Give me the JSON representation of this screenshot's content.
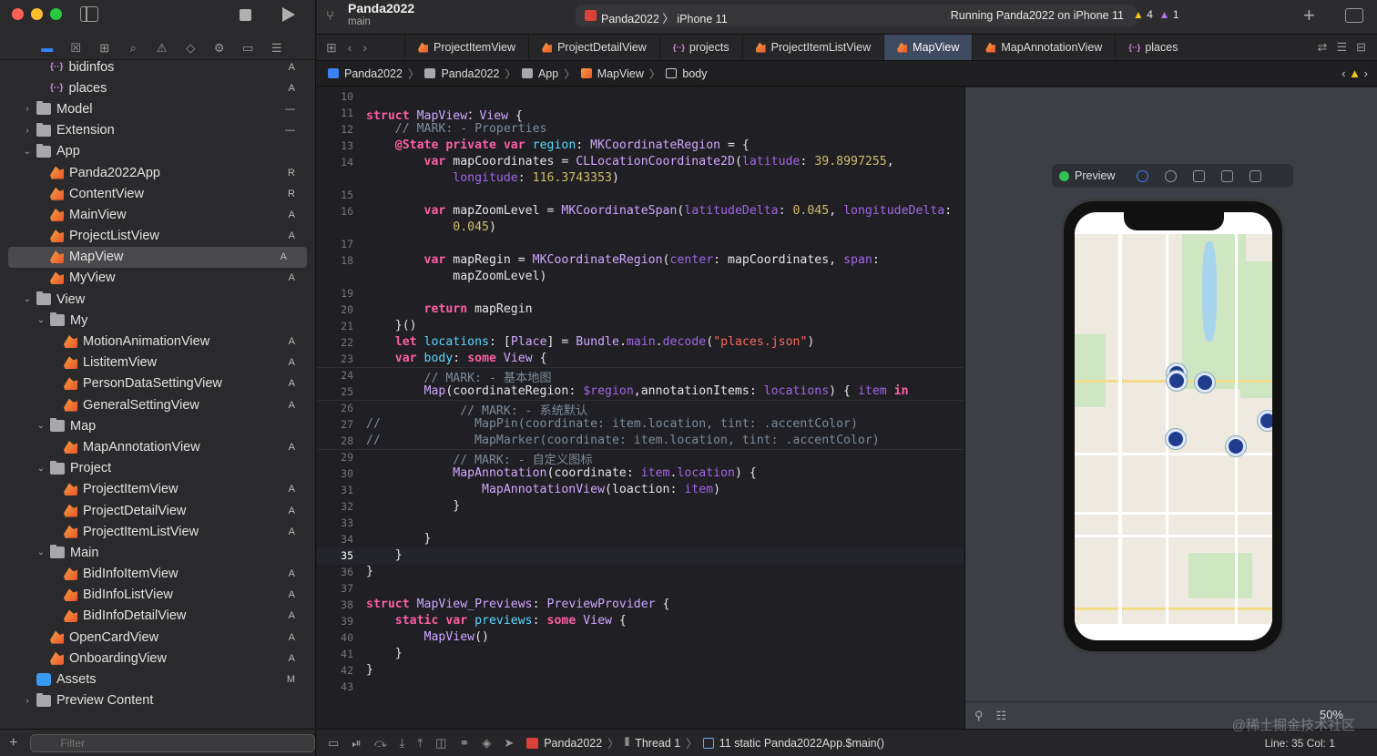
{
  "sidebar": {
    "filter_placeholder": "Filter",
    "items": [
      {
        "label": "bidinfos",
        "kind": "json",
        "indent": 1,
        "status": "A"
      },
      {
        "label": "places",
        "kind": "json",
        "indent": 1,
        "status": "A"
      },
      {
        "label": "Model",
        "kind": "folder",
        "indent": 0,
        "chev": "›",
        "status": "—"
      },
      {
        "label": "Extension",
        "kind": "folder",
        "indent": 0,
        "chev": "›",
        "status": "—"
      },
      {
        "label": "App",
        "kind": "folder",
        "indent": 0,
        "chev": "⌄",
        "status": ""
      },
      {
        "label": "Panda2022App",
        "kind": "swift",
        "indent": 1,
        "status": "R"
      },
      {
        "label": "ContentView",
        "kind": "swift",
        "indent": 1,
        "status": "R"
      },
      {
        "label": "MainView",
        "kind": "swift",
        "indent": 1,
        "status": "A"
      },
      {
        "label": "ProjectListView",
        "kind": "swift",
        "indent": 1,
        "status": "A"
      },
      {
        "label": "MapView",
        "kind": "swift",
        "indent": 1,
        "status": "A",
        "selected": true
      },
      {
        "label": "MyView",
        "kind": "swift",
        "indent": 1,
        "status": "A"
      },
      {
        "label": "View",
        "kind": "folder",
        "indent": 0,
        "chev": "⌄",
        "status": ""
      },
      {
        "label": "My",
        "kind": "folder",
        "indent": 1,
        "chev": "⌄",
        "status": ""
      },
      {
        "label": "MotionAnimationView",
        "kind": "swift",
        "indent": 2,
        "status": "A"
      },
      {
        "label": "ListitemView",
        "kind": "swift",
        "indent": 2,
        "status": "A"
      },
      {
        "label": "PersonDataSettingView",
        "kind": "swift",
        "indent": 2,
        "status": "A"
      },
      {
        "label": "GeneralSettingView",
        "kind": "swift",
        "indent": 2,
        "status": "A"
      },
      {
        "label": "Map",
        "kind": "folder",
        "indent": 1,
        "chev": "⌄",
        "status": ""
      },
      {
        "label": "MapAnnotationView",
        "kind": "swift",
        "indent": 2,
        "status": "A"
      },
      {
        "label": "Project",
        "kind": "folder",
        "indent": 1,
        "chev": "⌄",
        "status": ""
      },
      {
        "label": "ProjectItemView",
        "kind": "swift",
        "indent": 2,
        "status": "A"
      },
      {
        "label": "ProjectDetailView",
        "kind": "swift",
        "indent": 2,
        "status": "A"
      },
      {
        "label": "ProjectItemListView",
        "kind": "swift",
        "indent": 2,
        "status": "A"
      },
      {
        "label": "Main",
        "kind": "folder",
        "indent": 1,
        "chev": "⌄",
        "status": ""
      },
      {
        "label": "BidInfoItemView",
        "kind": "swift",
        "indent": 2,
        "status": "A"
      },
      {
        "label": "BidInfoListView",
        "kind": "swift",
        "indent": 2,
        "status": "A"
      },
      {
        "label": "BidInfoDetailView",
        "kind": "swift",
        "indent": 2,
        "status": "A"
      },
      {
        "label": "OpenCardView",
        "kind": "swift",
        "indent": 1,
        "status": "A"
      },
      {
        "label": "OnboardingView",
        "kind": "swift",
        "indent": 1,
        "status": "A"
      },
      {
        "label": "Assets",
        "kind": "assets",
        "indent": 0,
        "status": "M"
      },
      {
        "label": "Preview Content",
        "kind": "folder",
        "indent": 0,
        "chev": "›",
        "status": ""
      }
    ]
  },
  "toolbar": {
    "project": "Panda2022",
    "branch": "main",
    "scheme": "Panda2022",
    "device": "iPhone 11",
    "status": "Running Panda2022 on iPhone 11",
    "warnings": "4",
    "issues": "1"
  },
  "tabs": [
    {
      "label": "ProjectItemView",
      "icon": "swift"
    },
    {
      "label": "ProjectDetailView",
      "icon": "swift"
    },
    {
      "label": "projects",
      "icon": "json"
    },
    {
      "label": "ProjectItemListView",
      "icon": "swift"
    },
    {
      "label": "MapView",
      "icon": "swift",
      "active": true
    },
    {
      "label": "MapAnnotationView",
      "icon": "swift"
    },
    {
      "label": "places",
      "icon": "json"
    }
  ],
  "breadcrumb": [
    "Panda2022",
    "Panda2022",
    "App",
    "MapView",
    "body"
  ],
  "editor": {
    "current_line": 35,
    "lines": [
      {
        "n": 10,
        "segs": []
      },
      {
        "n": 11,
        "segs": [
          [
            "kw",
            "struct "
          ],
          [
            "ty2",
            "MapView"
          ],
          [
            "",
            "："
          ],
          [
            "ty2",
            "View"
          ],
          [
            "",
            " {"
          ]
        ]
      },
      {
        "n": 12,
        "segs": [
          [
            "cm",
            "    // MARK: - Properties"
          ]
        ]
      },
      {
        "n": 13,
        "segs": [
          [
            "kw",
            "    @State private var "
          ],
          [
            "ty",
            "region"
          ],
          [
            "",
            ": "
          ],
          [
            "ty2",
            "MKCoordinateRegion"
          ],
          [
            "",
            " = {"
          ]
        ]
      },
      {
        "n": 14,
        "segs": [
          [
            "kw",
            "        var "
          ],
          [
            "",
            "mapCoordinates = "
          ],
          [
            "ty2",
            "CLLocationCoordinate2D"
          ],
          [
            "",
            "("
          ],
          [
            "pr",
            "latitude"
          ],
          [
            "",
            ": "
          ],
          [
            "num",
            "39.8997255"
          ],
          [
            "",
            ","
          ]
        ]
      },
      {
        "n": null,
        "segs": [
          [
            "pr",
            "            longitude"
          ],
          [
            "",
            ": "
          ],
          [
            "num",
            "116.3743353"
          ],
          [
            "",
            ")"
          ]
        ]
      },
      {
        "n": 15,
        "segs": []
      },
      {
        "n": 16,
        "segs": [
          [
            "kw",
            "        var "
          ],
          [
            "",
            "mapZoomLevel = "
          ],
          [
            "ty2",
            "MKCoordinateSpan"
          ],
          [
            "",
            "("
          ],
          [
            "pr",
            "latitudeDelta"
          ],
          [
            "",
            ": "
          ],
          [
            "num",
            "0.045"
          ],
          [
            "",
            ", "
          ],
          [
            "pr",
            "longitudeDelta"
          ],
          [
            "",
            ":"
          ]
        ]
      },
      {
        "n": null,
        "segs": [
          [
            "num",
            "            0.045"
          ],
          [
            "",
            ")"
          ]
        ]
      },
      {
        "n": 17,
        "segs": []
      },
      {
        "n": 18,
        "segs": [
          [
            "kw",
            "        var "
          ],
          [
            "",
            "mapRegin = "
          ],
          [
            "ty2",
            "MKCoordinateRegion"
          ],
          [
            "",
            "("
          ],
          [
            "pr",
            "center"
          ],
          [
            "",
            ": mapCoordinates, "
          ],
          [
            "pr",
            "span"
          ],
          [
            "",
            ":"
          ]
        ]
      },
      {
        "n": null,
        "segs": [
          [
            "",
            "            mapZoomLevel)"
          ]
        ]
      },
      {
        "n": 19,
        "segs": []
      },
      {
        "n": 20,
        "segs": [
          [
            "kw",
            "        return "
          ],
          [
            "",
            "mapRegin"
          ]
        ]
      },
      {
        "n": 21,
        "segs": [
          [
            "",
            "    }()"
          ]
        ]
      },
      {
        "n": 22,
        "segs": [
          [
            "kw",
            "    let "
          ],
          [
            "ty",
            "locations"
          ],
          [
            "",
            ": ["
          ],
          [
            "ty2",
            "Place"
          ],
          [
            "",
            "] = "
          ],
          [
            "ty2",
            "Bundle"
          ],
          [
            "",
            "."
          ],
          [
            "pr",
            "main"
          ],
          [
            "",
            "."
          ],
          [
            "pr",
            "decode"
          ],
          [
            "",
            "("
          ],
          [
            "str",
            "\"places.json\""
          ],
          [
            "",
            ")"
          ]
        ]
      },
      {
        "n": 23,
        "segs": [
          [
            "kw",
            "    var "
          ],
          [
            "ty",
            "body"
          ],
          [
            "",
            ": "
          ],
          [
            "kw",
            "some "
          ],
          [
            "ty2",
            "View"
          ],
          [
            "",
            " {"
          ]
        ]
      },
      {
        "n": 24,
        "segs": [
          [
            "cm",
            "        // MARK: - 基本地图"
          ]
        ]
      },
      {
        "n": 25,
        "segs": [
          [
            "ty2",
            "        Map"
          ],
          [
            "",
            "(coordinateRegion: "
          ],
          [
            "pr",
            "$region"
          ],
          [
            "",
            ",annotationItems: "
          ],
          [
            "pr",
            "locations"
          ],
          [
            "",
            ") { "
          ],
          [
            "pr",
            "item "
          ],
          [
            "kw",
            "in"
          ]
        ]
      },
      {
        "n": 26,
        "segs": [
          [
            "cm",
            "             // MARK: - 系统默认"
          ]
        ]
      },
      {
        "n": 27,
        "segs": [
          [
            "cm",
            "//             MapPin(coordinate: item.location, tint: .accentColor)"
          ]
        ]
      },
      {
        "n": 28,
        "segs": [
          [
            "cm",
            "//             MapMarker(coordinate: item.location, tint: .accentColor)"
          ]
        ]
      },
      {
        "n": 29,
        "segs": [
          [
            "cm",
            "            // MARK: - 自定义图标"
          ]
        ]
      },
      {
        "n": 30,
        "segs": [
          [
            "ty2",
            "            MapAnnotation"
          ],
          [
            "",
            "(coordinate: "
          ],
          [
            "pr",
            "item"
          ],
          [
            "",
            "."
          ],
          [
            "pr",
            "location"
          ],
          [
            "",
            ") {"
          ]
        ]
      },
      {
        "n": 31,
        "segs": [
          [
            "ty2",
            "                MapAnnotationView"
          ],
          [
            "",
            "(loaction: "
          ],
          [
            "pr",
            "item"
          ],
          [
            "",
            ")"
          ]
        ]
      },
      {
        "n": 32,
        "segs": [
          [
            "",
            "            }"
          ]
        ]
      },
      {
        "n": 33,
        "segs": []
      },
      {
        "n": 34,
        "segs": [
          [
            "",
            "        }"
          ]
        ]
      },
      {
        "n": 35,
        "segs": [
          [
            "",
            "    }"
          ]
        ]
      },
      {
        "n": 36,
        "segs": [
          [
            "",
            "}"
          ]
        ]
      },
      {
        "n": 37,
        "segs": []
      },
      {
        "n": 38,
        "segs": [
          [
            "kw",
            "struct "
          ],
          [
            "ty2",
            "MapView_Previews"
          ],
          [
            "",
            ": "
          ],
          [
            "ty2",
            "PreviewProvider"
          ],
          [
            "",
            " {"
          ]
        ]
      },
      {
        "n": 39,
        "segs": [
          [
            "kw",
            "    static var "
          ],
          [
            "ty",
            "previews"
          ],
          [
            "",
            ": "
          ],
          [
            "kw",
            "some "
          ],
          [
            "ty2",
            "View"
          ],
          [
            "",
            " {"
          ]
        ]
      },
      {
        "n": 40,
        "segs": [
          [
            "ty2",
            "        MapView"
          ],
          [
            "",
            "()"
          ]
        ]
      },
      {
        "n": 41,
        "segs": [
          [
            "",
            "    }"
          ]
        ]
      },
      {
        "n": 42,
        "segs": [
          [
            "",
            "}"
          ]
        ]
      },
      {
        "n": 43,
        "segs": []
      }
    ]
  },
  "preview": {
    "label": "Preview",
    "zoom": "50%"
  },
  "statusbar": {
    "scheme": "Panda2022",
    "thread": "Thread 1",
    "frame": "11 static Panda2022App.$main()",
    "position": "Line: 35  Col: 1"
  },
  "watermark": "@稀土掘金技术社区",
  "colors": {
    "accent": "#3a82f7",
    "keyword": "#fc5fa3",
    "type": "#d0a8ff",
    "comment": "#7f8c98"
  }
}
